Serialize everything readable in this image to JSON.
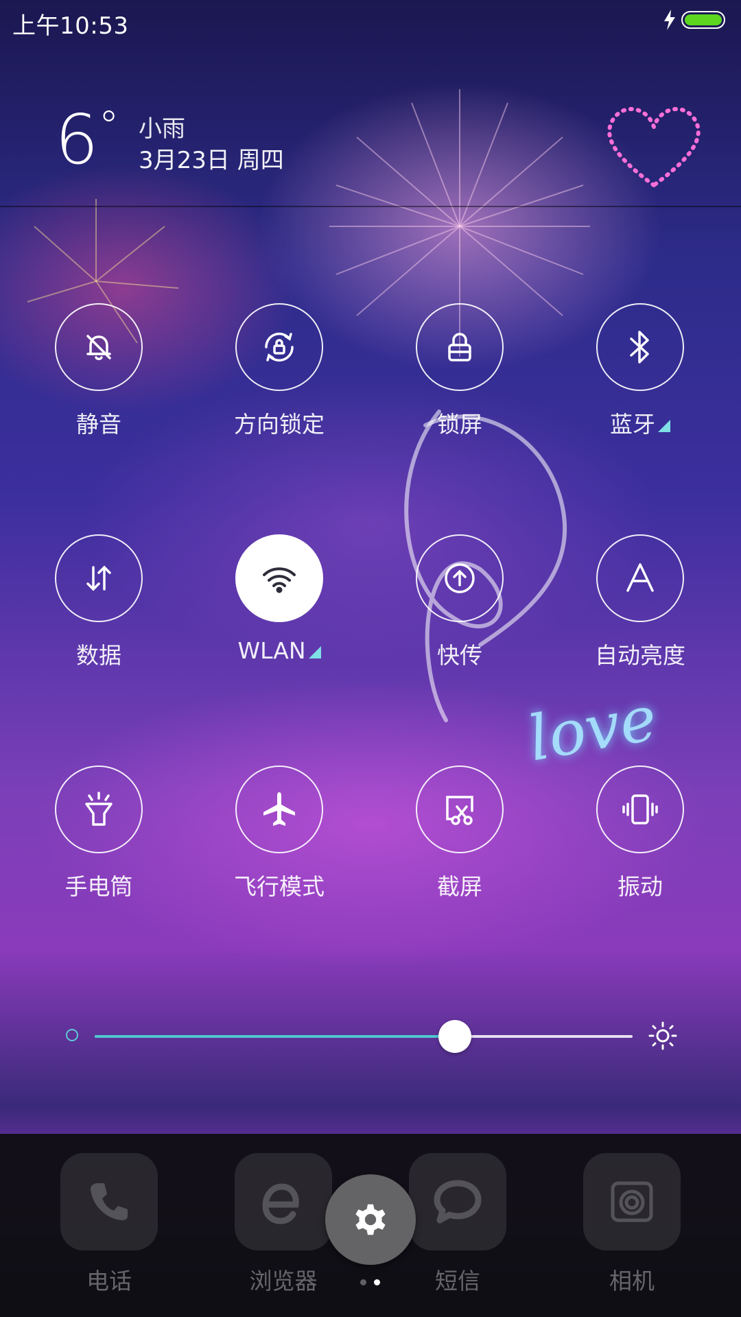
{
  "status_bar": {
    "time": "上午10:53",
    "battery_color": "#5cd61f"
  },
  "header": {
    "temperature": "6",
    "degree_symbol": "°",
    "weather": "小雨",
    "date": "3月23日 周四"
  },
  "toggles": [
    {
      "label": "静音",
      "icon": "bell-off-icon",
      "active": false,
      "has_more": false
    },
    {
      "label": "方向锁定",
      "icon": "rotation-lock-icon",
      "active": false,
      "has_more": false
    },
    {
      "label": "锁屏",
      "icon": "lock-icon",
      "active": false,
      "has_more": false
    },
    {
      "label": "蓝牙",
      "icon": "bluetooth-icon",
      "active": false,
      "has_more": true
    },
    {
      "label": "数据",
      "icon": "mobile-data-icon",
      "active": false,
      "has_more": false
    },
    {
      "label": "WLAN",
      "icon": "wifi-icon",
      "active": true,
      "has_more": true
    },
    {
      "label": "快传",
      "icon": "upload-icon",
      "active": false,
      "has_more": false
    },
    {
      "label": "自动亮度",
      "icon": "auto-brightness-icon",
      "active": false,
      "has_more": false
    },
    {
      "label": "手电筒",
      "icon": "flashlight-icon",
      "active": false,
      "has_more": false
    },
    {
      "label": "飞行模式",
      "icon": "airplane-icon",
      "active": false,
      "has_more": false
    },
    {
      "label": "截屏",
      "icon": "screenshot-icon",
      "active": false,
      "has_more": false
    },
    {
      "label": "振动",
      "icon": "vibrate-icon",
      "active": false,
      "has_more": false
    }
  ],
  "brightness": {
    "level": 0.67,
    "accent_color": "#4fc6d0"
  },
  "wallpaper_text": {
    "love": "love"
  },
  "dock": {
    "apps": [
      {
        "label": "电话",
        "icon": "phone-icon"
      },
      {
        "label": "浏览器",
        "icon": "browser-icon"
      },
      {
        "label": "短信",
        "icon": "message-icon"
      },
      {
        "label": "相机",
        "icon": "camera-icon"
      }
    ],
    "settings_icon": "gear-icon",
    "pages": 2,
    "current_page": 2
  }
}
